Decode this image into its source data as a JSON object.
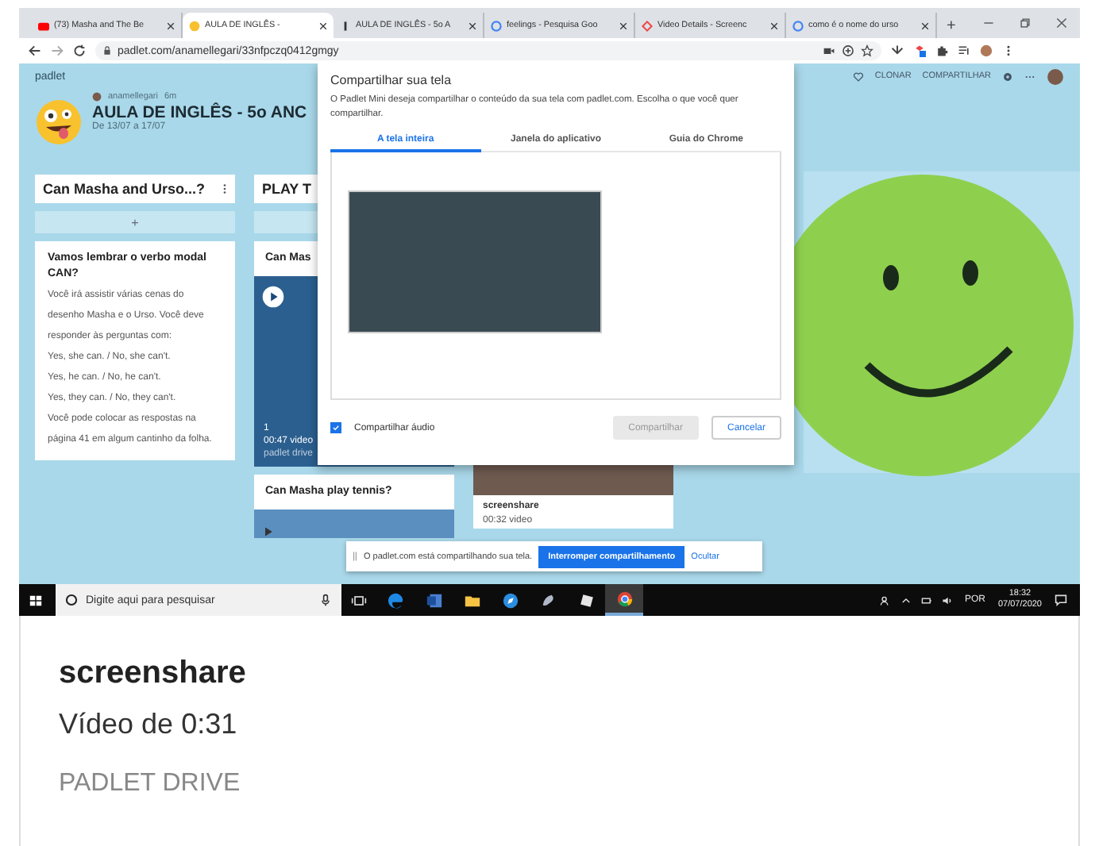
{
  "browser": {
    "tabs": [
      {
        "title": "(73) Masha and The Be",
        "kind": "youtube",
        "selected": false
      },
      {
        "title": "AULA DE INGLÊS -",
        "kind": "emoji",
        "selected": true
      },
      {
        "title": "AULA DE INGLÊS - 5o A",
        "kind": "figure",
        "selected": false
      },
      {
        "title": "feelings - Pesquisa Goo",
        "kind": "google",
        "selected": false
      },
      {
        "title": "Video Details - Screenc",
        "kind": "screencast",
        "selected": false
      },
      {
        "title": "como é o nome do urso",
        "kind": "google",
        "selected": false
      }
    ],
    "new_tab": "+",
    "address": "padlet.com/anamellegari/33nfpczq0412gmgy"
  },
  "padlet": {
    "brand": "padlet",
    "actions": [
      "CLONAR",
      "COMPARTILHAR"
    ],
    "author": "anamellegari",
    "age": "6m",
    "title": "AULA DE INGLÊS - 5o ANC",
    "dates": "De 13/07 a 17/07",
    "columns": [
      {
        "title": "Can Masha and Urso...?",
        "menu": true,
        "add": "+",
        "cards": [
          {
            "kind": "text",
            "title": "Vamos lembrar o verbo modal CAN?",
            "paragraphs": [
              "Você irá assistir várias cenas do desenho Masha e o Urso. Você deve responder às perguntas com:",
              "Yes, she can. / No, she can't.",
              "Yes, he can. / No, he can't.",
              "Yes, they can. / No, they can't.",
              "Você pode colocar as respostas na página 41 em algum cantinho da folha."
            ]
          }
        ]
      },
      {
        "title": "PLAY T",
        "cards": [
          {
            "kind": "video",
            "title": "Can Mas",
            "lines": [
              "1",
              "00:47 video",
              "padlet drive"
            ]
          },
          {
            "kind": "thumb",
            "title": "Can Masha play tennis?"
          }
        ]
      },
      {
        "cards": [
          {
            "kind": "attachment",
            "lines": [
              "screenshare",
              "00:32 video"
            ]
          }
        ]
      }
    ]
  },
  "dialog": {
    "title": "Compartilhar sua tela",
    "message": "O Padlet Mini deseja compartilhar o conteúdo da sua tela com padlet.com. Escolha o que você quer compartilhar.",
    "tabs": [
      {
        "label": "A tela inteira",
        "selected": true
      },
      {
        "label": "Janela do aplicativo",
        "selected": false
      },
      {
        "label": "Guia do Chrome",
        "selected": false
      }
    ],
    "audio": {
      "label": "Compartilhar áudio",
      "checked": true
    },
    "buttons": [
      {
        "label": "Compartilhar",
        "disabled": true
      },
      {
        "label": "Cancelar",
        "disabled": false
      }
    ]
  },
  "share_bar": {
    "message": "O padlet.com está compartilhando sua tela.",
    "stop": "Interromper compartilhamento",
    "hide": "Ocultar"
  },
  "taskbar": {
    "search": "Digite aqui para pesquisar",
    "apps": [
      {
        "kind": "edge",
        "selected": false
      },
      {
        "kind": "word",
        "selected": false
      },
      {
        "kind": "folder",
        "selected": false
      },
      {
        "kind": "compass",
        "selected": false
      },
      {
        "kind": "paint",
        "selected": false
      },
      {
        "kind": "cube",
        "selected": false
      },
      {
        "kind": "chrome",
        "selected": true
      }
    ],
    "language": "POR",
    "time": "18:32",
    "date": "07/07/2020"
  },
  "caption": {
    "title": "screenshare",
    "subtitle": "Vídeo de 0:31",
    "source": "PADLET DRIVE"
  }
}
